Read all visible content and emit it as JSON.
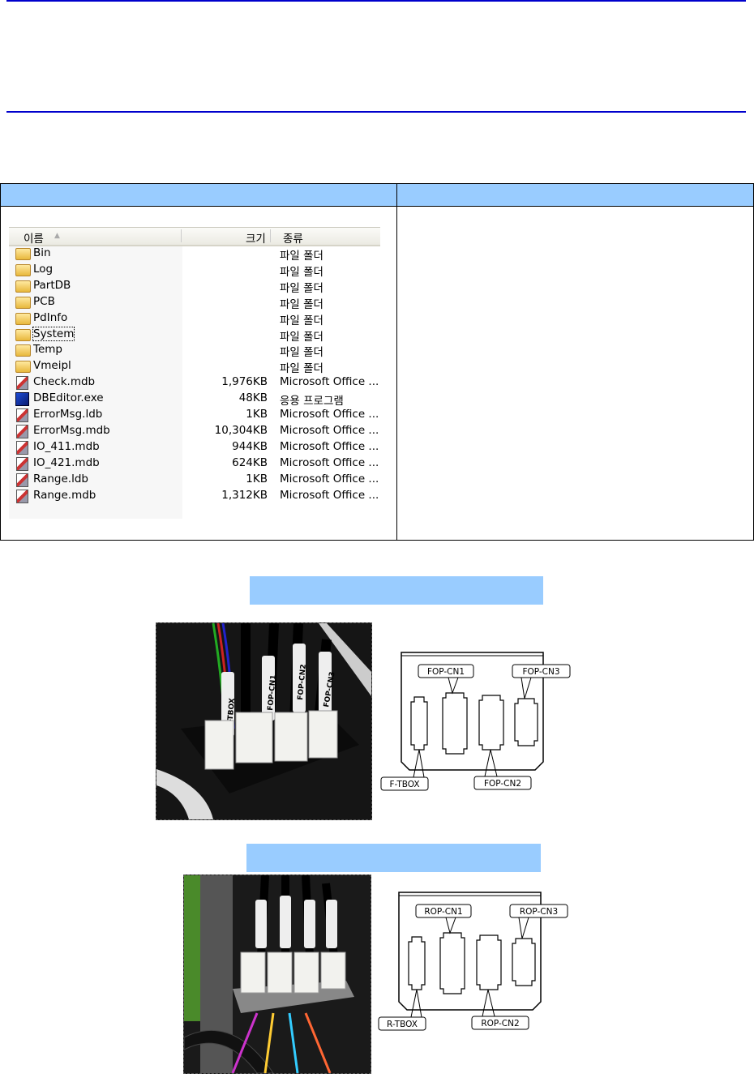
{
  "explorer": {
    "columns": {
      "name": "이름",
      "size": "크기",
      "type": "종류"
    },
    "rows": [
      {
        "name": "Bin",
        "size": "",
        "type": "파일 폴더",
        "icon": "folder-icon"
      },
      {
        "name": "Log",
        "size": "",
        "type": "파일 폴더",
        "icon": "folder-icon"
      },
      {
        "name": "PartDB",
        "size": "",
        "type": "파일 폴더",
        "icon": "folder-icon"
      },
      {
        "name": "PCB",
        "size": "",
        "type": "파일 폴더",
        "icon": "folder-icon"
      },
      {
        "name": "PdInfo",
        "size": "",
        "type": "파일 폴더",
        "icon": "folder-icon"
      },
      {
        "name": "System",
        "size": "",
        "type": "파일 폴더",
        "icon": "folder-icon"
      },
      {
        "name": "Temp",
        "size": "",
        "type": "파일 폴더",
        "icon": "folder-icon"
      },
      {
        "name": "Vmeipl",
        "size": "",
        "type": "파일 폴더",
        "icon": "folder-icon"
      },
      {
        "name": "Check.mdb",
        "size": "1,976KB",
        "type": "Microsoft Office ...",
        "icon": "access-db-icon"
      },
      {
        "name": "DBEditor.exe",
        "size": "48KB",
        "type": "응용 프로그램",
        "icon": "application-icon"
      },
      {
        "name": "ErrorMsg.ldb",
        "size": "1KB",
        "type": "Microsoft Office ...",
        "icon": "access-db-icon"
      },
      {
        "name": "ErrorMsg.mdb",
        "size": "10,304KB",
        "type": "Microsoft Office ...",
        "icon": "access-db-icon"
      },
      {
        "name": "IO_411.mdb",
        "size": "944KB",
        "type": "Microsoft Office ...",
        "icon": "access-db-icon"
      },
      {
        "name": "IO_421.mdb",
        "size": "624KB",
        "type": "Microsoft Office ...",
        "icon": "access-db-icon"
      },
      {
        "name": "Range.ldb",
        "size": "1KB",
        "type": "Microsoft Office ...",
        "icon": "access-db-icon"
      },
      {
        "name": "Range.mdb",
        "size": "1,312KB",
        "type": "Microsoft Office ...",
        "icon": "access-db-icon"
      }
    ],
    "selected": "System"
  },
  "front": {
    "photo_labels": [
      "F-TBOX",
      "FOP-CN1",
      "FOP-CN2",
      "FOP-CN3"
    ],
    "diagram": {
      "cn1": "FOP-CN1",
      "cn2": "FOP-CN2",
      "cn3": "FOP-CN3",
      "tbox": "F-TBOX"
    }
  },
  "rear": {
    "diagram": {
      "cn1": "ROP-CN1",
      "cn2": "ROP-CN2",
      "cn3": "ROP-CN3",
      "tbox": "R-TBOX"
    }
  },
  "colors": {
    "rule": "#0000cc",
    "header_fill": "#99ccff"
  }
}
